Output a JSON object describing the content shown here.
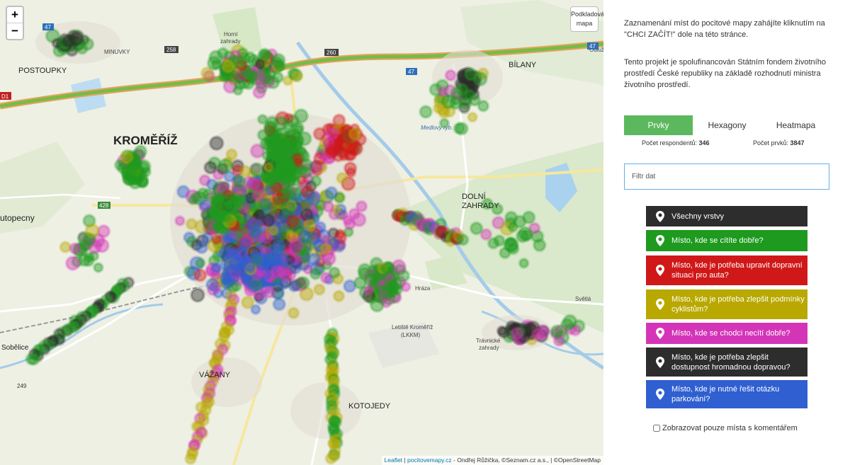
{
  "map": {
    "zoom_in": "+",
    "zoom_out": "−",
    "basemap_label": "Podkladová mapa",
    "attribution": {
      "leaflet": "Leaflet",
      "site": "pocitovemapy.cz",
      "rest": " - Ondřej Růžička, ©Seznam.cz a.s., | ©OpenStreetMap"
    },
    "place_labels": {
      "kromeriz": "KROMĚŘÍŽ",
      "postoupky": "POSTOUPKY",
      "bilany": "BÍLANY",
      "dolni_zahrady_1": "DOLNÍ",
      "dolni_zahrady_2": "ZAHRADY",
      "vazany": "VÁŽANY",
      "kotojedy": "KOTOJEDY",
      "sobelice": "Sobělice",
      "utopecny": "utopecny",
      "minuvky": "MINUVKY",
      "horni_zahrady_1": "Horní",
      "horni_zahrady_2": "zahrady",
      "letiste_1": "Letiště Kroměříž",
      "letiste_2": "(LKKM)",
      "svetla": "Světlá",
      "hraza": "Hráza",
      "odluz": "Odluž",
      "travnik_1": "Trávnické",
      "travnik_2": "zahrady",
      "medlovky": "Medlovy ryb."
    },
    "road_numbers": [
      "47",
      "47",
      "47",
      "258",
      "260",
      "428",
      "249",
      "D1"
    ]
  },
  "panel": {
    "intro_1": "Zaznamenání míst do pocitové mapy zahájíte kliknutím na \"CHCI ZAČÍT!\" dole na této stránce.",
    "intro_2": "Tento projekt je spolufinancován Státním fondem životního prostředí České republiky na základě rozhodnutí ministra životního prostředí.",
    "tabs": [
      {
        "label": "Prvky",
        "active": true
      },
      {
        "label": "Hexagony",
        "active": false
      },
      {
        "label": "Heatmapa",
        "active": false
      }
    ],
    "respondents_label": "Počet respondentů:",
    "respondents_value": "346",
    "items_label": "Počet prvků:",
    "items_value": "3847",
    "filter_placeholder": "Filtr dat",
    "layers": [
      {
        "label": "Všechny vrstvy",
        "color": "#2d2d2d"
      },
      {
        "label": "Místo, kde se cítíte dobře?",
        "color": "#1e9a1e"
      },
      {
        "label": "Místo, kde je potřeba upravit dopravní situaci pro auta?",
        "color": "#d01818"
      },
      {
        "label": "Místo, kde je potřeba zlepšit podmínky cyklistům?",
        "color": "#b8a800"
      },
      {
        "label": "Místo, kde se chodci necítí dobře?",
        "color": "#d435b8"
      },
      {
        "label": "Místo, kde je potřeba zlepšit dostupnost hromadnou dopravou?",
        "color": "#2d2d2d"
      },
      {
        "label": "Místo, kde je nutné řešit otázku parkování?",
        "color": "#2f5fd0"
      }
    ],
    "comments_only_label": "Zobrazovat pouze místa s komentářem"
  },
  "colors": {
    "green": "#1e9a1e",
    "red": "#d01818",
    "yellow": "#b8a800",
    "magenta": "#d435b8",
    "black": "#2d2d2d",
    "blue": "#2f5fd0",
    "tab_active": "#5cb85c"
  }
}
